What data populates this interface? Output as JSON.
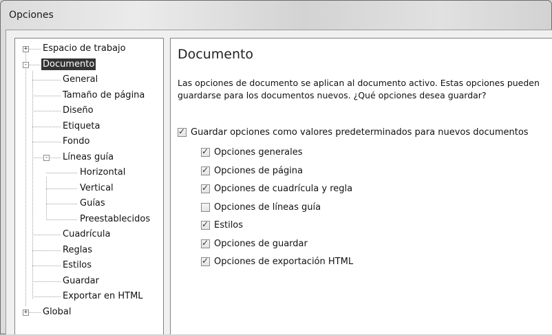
{
  "window": {
    "title": "Opciones"
  },
  "tree": {
    "nodes": [
      {
        "label": "Espacio de trabajo",
        "expander": "+"
      },
      {
        "label": "Documento",
        "expander": "-",
        "selected": true
      },
      {
        "label": "General"
      },
      {
        "label": "Tamaño de página"
      },
      {
        "label": "Diseño"
      },
      {
        "label": "Etiqueta"
      },
      {
        "label": "Fondo"
      },
      {
        "label": "Líneas guía",
        "expander": "-"
      },
      {
        "label": "Horizontal"
      },
      {
        "label": "Vertical"
      },
      {
        "label": "Guías"
      },
      {
        "label": "Preestablecidos"
      },
      {
        "label": "Cuadrícula"
      },
      {
        "label": "Reglas"
      },
      {
        "label": "Estilos"
      },
      {
        "label": "Guardar"
      },
      {
        "label": "Exportar en HTML"
      },
      {
        "label": "Global",
        "expander": "+"
      }
    ]
  },
  "panel": {
    "heading": "Documento",
    "description": "Las opciones de documento se aplican al documento activo. Estas opciones pueden guardarse para los documentos nuevos. ¿Qué opciones desea guardar?",
    "master_checkbox": {
      "label": "Guardar opciones como valores predeterminados para nuevos documentos",
      "checked": true
    },
    "options": [
      {
        "label": "Opciones generales",
        "checked": true
      },
      {
        "label": "Opciones de página",
        "checked": true
      },
      {
        "label": "Opciones de cuadrícula y regla",
        "checked": true
      },
      {
        "label": "Opciones de líneas guía",
        "checked": false
      },
      {
        "label": "Estilos",
        "checked": true
      },
      {
        "label": "Opciones de guardar",
        "checked": true
      },
      {
        "label": "Opciones de exportación HTML",
        "checked": true
      }
    ]
  }
}
